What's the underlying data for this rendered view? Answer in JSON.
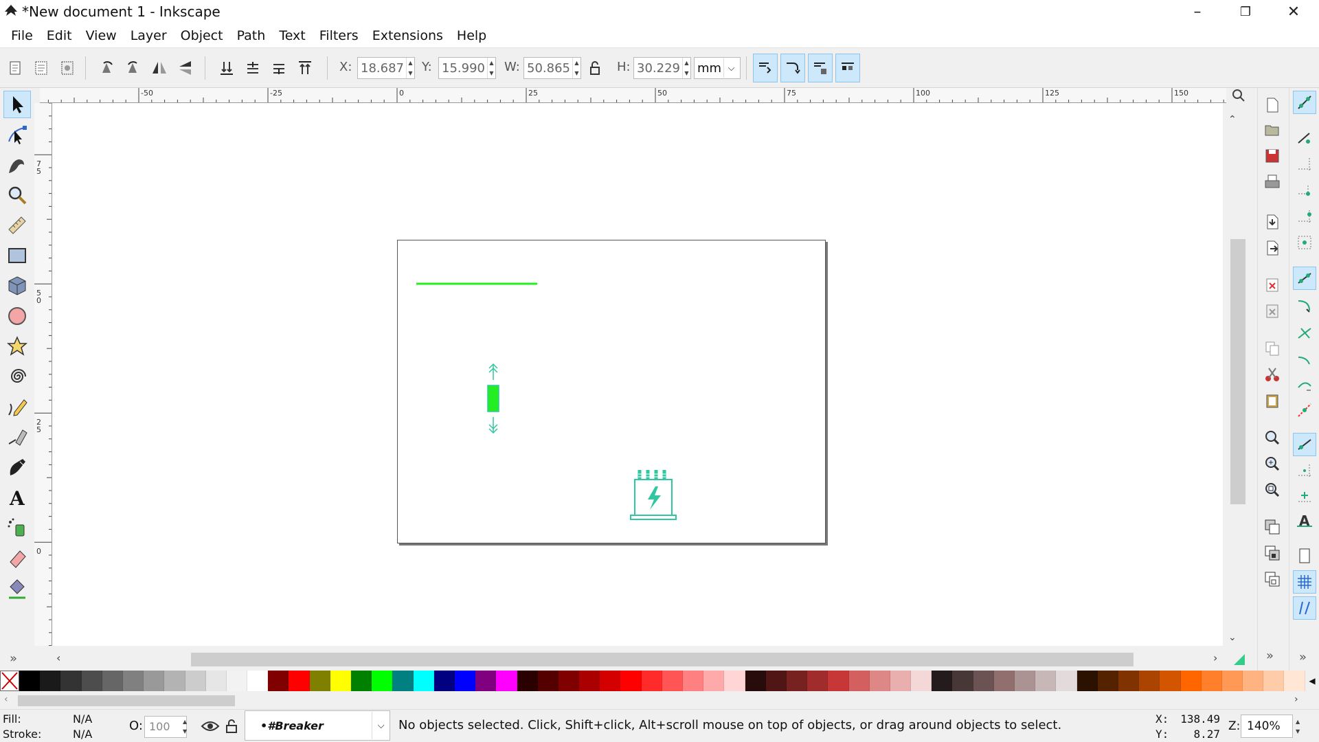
{
  "window": {
    "title": "*New document 1 - Inkscape",
    "minimize": "–",
    "restore": "❐",
    "close": "✕"
  },
  "menu": [
    "File",
    "Edit",
    "View",
    "Layer",
    "Object",
    "Path",
    "Text",
    "Filters",
    "Extensions",
    "Help"
  ],
  "toolbar": {
    "x_label": "X:",
    "x_value": "18.687",
    "y_label": "Y:",
    "y_value": "15.990",
    "w_label": "W:",
    "w_value": "50.865",
    "h_label": "H:",
    "h_value": "30.229",
    "unit": "mm"
  },
  "ruler": {
    "h_labels": [
      "-50",
      "-25",
      "0",
      "25",
      "50",
      "75",
      "100",
      "125",
      "150"
    ],
    "v_labels": [
      "75",
      "50",
      "25",
      "0"
    ]
  },
  "drawing": {
    "line_color": "#22ee22",
    "rect_color": "#22ee22",
    "icon_color": "#2fc7a0"
  },
  "palette": [
    "#000000",
    "#1a1a1a",
    "#333333",
    "#4d4d4d",
    "#666666",
    "#808080",
    "#999999",
    "#b3b3b3",
    "#cccccc",
    "#e6e6e6",
    "#f2f2f2",
    "#ffffff",
    "#800000",
    "#ff0000",
    "#808000",
    "#ffff00",
    "#008000",
    "#00ff00",
    "#008080",
    "#00ffff",
    "#000080",
    "#0000ff",
    "#800080",
    "#ff00ff",
    "#2b0000",
    "#550000",
    "#800000",
    "#aa0000",
    "#d40000",
    "#ff0000",
    "#ff2a2a",
    "#ff5555",
    "#ff8080",
    "#ffaaaa",
    "#ffd5d5",
    "#280b0b",
    "#501616",
    "#782121",
    "#a02c2c",
    "#c83737",
    "#d35f5f",
    "#de8787",
    "#e9afaf",
    "#f4d7d7",
    "#241c1c",
    "#483737",
    "#6c5353",
    "#916f6f",
    "#ac9393",
    "#c8b7b7",
    "#e3dbdb",
    "#2b1100",
    "#552200",
    "#803300",
    "#aa4400",
    "#d45500",
    "#ff6600",
    "#ff7f2a",
    "#ff9955",
    "#ffb380",
    "#ffccaa",
    "#ffe6d5"
  ],
  "status": {
    "fill_label": "Fill:",
    "fill_value": "N/A",
    "stroke_label": "Stroke:",
    "stroke_value": "N/A",
    "opacity_label": "O:",
    "opacity_value": "100",
    "layer": "•#Breaker",
    "message": "No objects selected. Click, Shift+click, Alt+scroll mouse on top of objects, or drag around objects to select.",
    "cursor_x_label": "X:",
    "cursor_x": "138.49",
    "cursor_y_label": "Y:",
    "cursor_y": "8.27",
    "zoom_label": "Z:",
    "zoom": "140%"
  }
}
